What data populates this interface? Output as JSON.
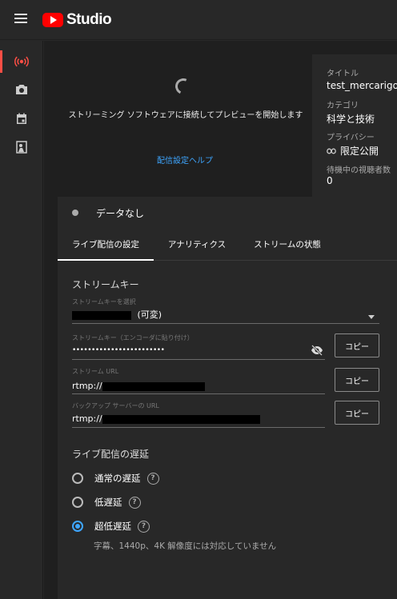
{
  "app": {
    "logo_text": "Studio"
  },
  "sidebar": {
    "items": [
      {
        "icon": "live-broadcast-icon",
        "active": true
      },
      {
        "icon": "camera-icon",
        "active": false
      },
      {
        "icon": "calendar-icon",
        "active": false
      },
      {
        "icon": "person-screen-icon",
        "active": false
      }
    ]
  },
  "preview": {
    "message": "ストリーミング ソフトウェアに接続してプレビューを開始します",
    "help_link": "配信設定ヘルプ"
  },
  "info": {
    "title_label": "タイトル",
    "title_value": "test_mercarigo",
    "category_label": "カテゴリ",
    "category_value": "科学と技術",
    "privacy_label": "プライバシー",
    "privacy_value": "限定公開",
    "viewers_label": "待機中の視聴者数",
    "viewers_value": "0"
  },
  "status": {
    "no_data": "データなし"
  },
  "tabs": [
    {
      "label": "ライブ配信の設定",
      "active": true
    },
    {
      "label": "アナリティクス",
      "active": false
    },
    {
      "label": "ストリームの状態",
      "active": false
    }
  ],
  "stream_key": {
    "section_title": "ストリームキー",
    "select_label": "ストリームキーを選択",
    "select_value_suffix": "(可変)",
    "key_label": "ストリームキー（エンコーダに貼り付け）",
    "key_value": "••••••••••••••••••••••••",
    "url_label": "ストリーム URL",
    "url_value": "rtmp://",
    "backup_label": "バックアップ サーバーの URL",
    "backup_value": "rtmp://",
    "copy_label": "コピー"
  },
  "latency": {
    "section_title": "ライブ配信の遅延",
    "options": [
      {
        "label": "通常の遅延",
        "checked": false
      },
      {
        "label": "低遅延",
        "checked": false
      },
      {
        "label": "超低遅延",
        "checked": true
      }
    ],
    "note": "字幕、1440p、4K 解像度には対応していません"
  },
  "colors": {
    "accent": "#3ea6ff",
    "active_indicator": "#ff4e45",
    "brand_red": "#ff0000"
  }
}
